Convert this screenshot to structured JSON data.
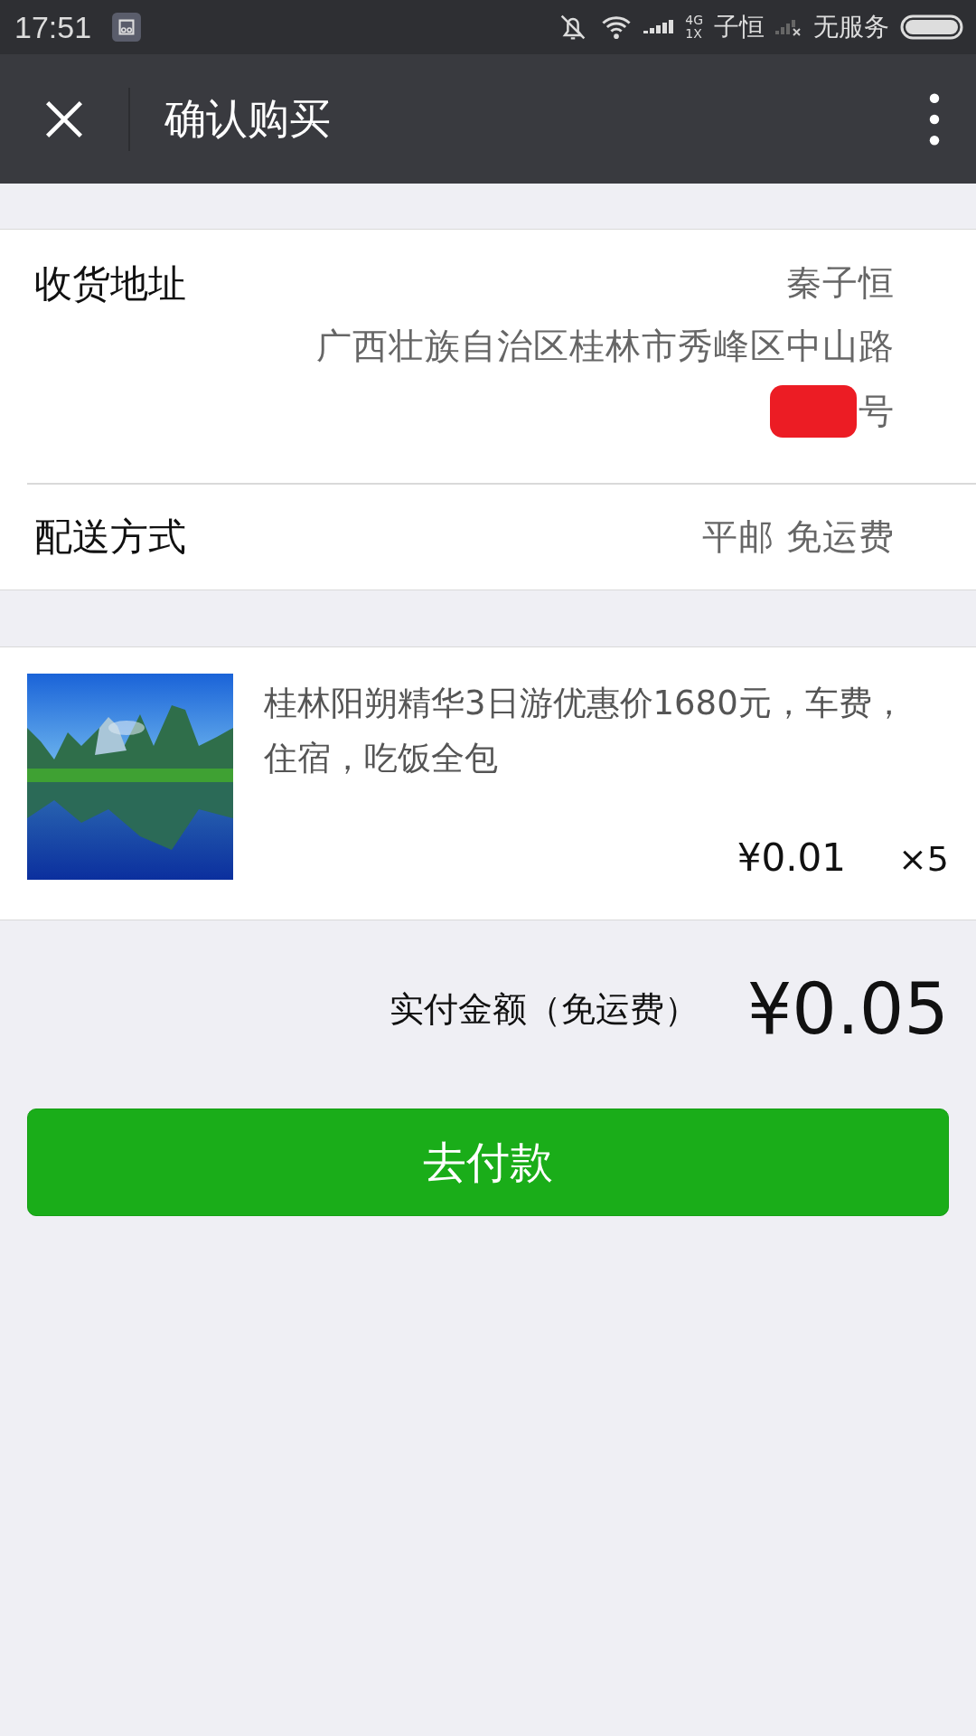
{
  "status_bar": {
    "time": "17:51",
    "network_label": "4G",
    "network_sub": "1X",
    "carrier_1": "子恒",
    "carrier_2": "无服务"
  },
  "nav_bar": {
    "title": "确认购买"
  },
  "address": {
    "label": "收货地址",
    "name": "秦子恒",
    "line_1": "广西壮族自治区桂林市秀峰区中山路",
    "line_2": "号"
  },
  "delivery": {
    "label": "配送方式",
    "value": "平邮 免运费"
  },
  "product": {
    "title": "桂林阳朔精华3日游优惠价1680元，车费，住宿，吃饭全包",
    "price": "¥0.01",
    "quantity": "×5"
  },
  "total": {
    "label": "实付金额（免运费）",
    "amount": "¥0.05"
  },
  "pay_button": "去付款"
}
